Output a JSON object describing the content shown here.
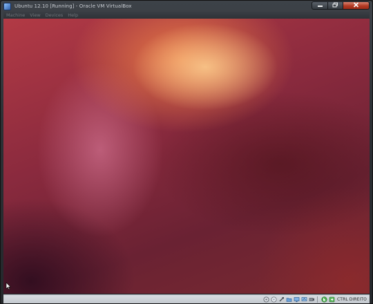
{
  "window": {
    "title": "Ubuntu 12.10 [Running] - Oracle VM VirtualBox",
    "controls": {
      "minimize": "▬",
      "maximize": "❐",
      "close": "✕"
    }
  },
  "menu": {
    "items": [
      "Machine",
      "View",
      "Devices",
      "Help"
    ]
  },
  "statusbar": {
    "device_icons": [
      "hard-disk-icon",
      "optical-drive-icon",
      "usb-icon",
      "shared-folders-icon",
      "display-icon",
      "network-icon",
      "video-capture-icon",
      "mouse-integration-icon"
    ],
    "host_key_label": "CTRL DIREITO"
  },
  "colors": {
    "wallpaper_orange": "#ee8046",
    "wallpaper_aubergine": "#6e2436",
    "close_button": "#b23a24"
  }
}
